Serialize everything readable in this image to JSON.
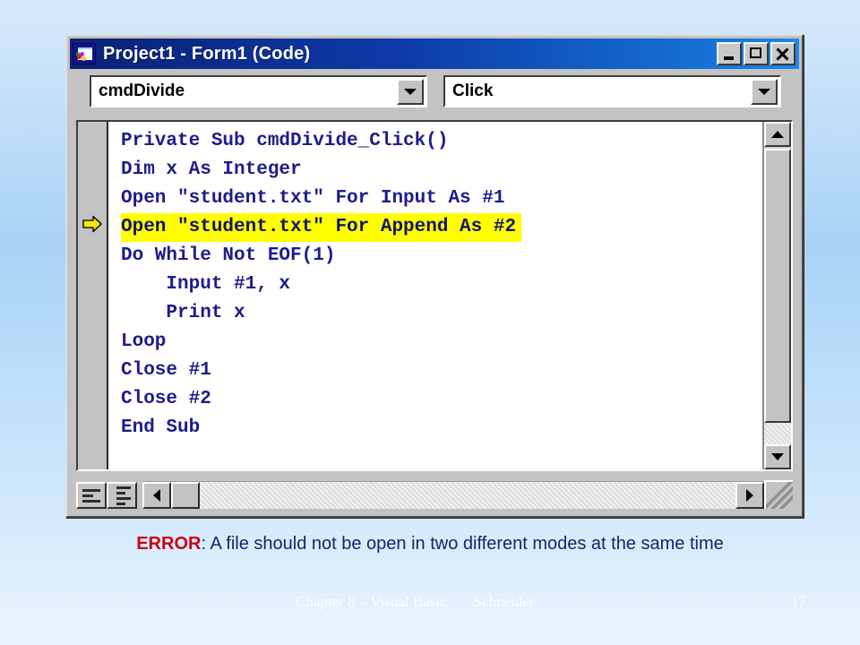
{
  "window": {
    "title": "Project1 - Form1 (Code)",
    "icon": "vb-form-icon",
    "buttons": {
      "minimize": "minimize-button",
      "maximize": "maximize-button",
      "close": "close-button"
    }
  },
  "toolbar": {
    "object_combo": {
      "value": "cmdDivide",
      "arrow": "chevron-down-icon"
    },
    "procedure_combo": {
      "value": "Click",
      "arrow": "chevron-down-icon"
    }
  },
  "code": {
    "margin_indicator": "execution-arrow-icon",
    "highlighted_index": 3,
    "lines": [
      "Private Sub cmdDivide_Click()",
      "Dim x As Integer",
      "Open \"student.txt\" For Input As #1",
      "Open \"student.txt\" For Append As #2",
      "Do While Not EOF(1)",
      "    Input #1, x",
      "    Print x",
      "Loop",
      "Close #1",
      "Close #2",
      "End Sub"
    ]
  },
  "scrollbars": {
    "vertical": {
      "up": "scroll-up-icon",
      "down": "scroll-down-icon"
    },
    "horizontal": {
      "left": "scroll-left-icon",
      "right": "scroll-right-icon"
    }
  },
  "view_buttons": {
    "procedure_view": "procedure-view-button",
    "full_module_view": "full-module-view-button"
  },
  "caption": {
    "error_label": "ERROR",
    "message": ": A file should not be open in two different modes at the same time"
  },
  "footer": {
    "chapter": "Chapter 8 – Visual Basic",
    "author": "Schneider",
    "page": "17"
  },
  "colors": {
    "titlebar_start": "#0b2175",
    "titlebar_end": "#1f88ea",
    "code_text": "#1c1c8c",
    "highlight_bg": "#ffff00",
    "error_red": "#cc0011",
    "caption_navy": "#15256b",
    "window_face": "#c3c3c3",
    "background_blue": "#a8d2f5"
  }
}
